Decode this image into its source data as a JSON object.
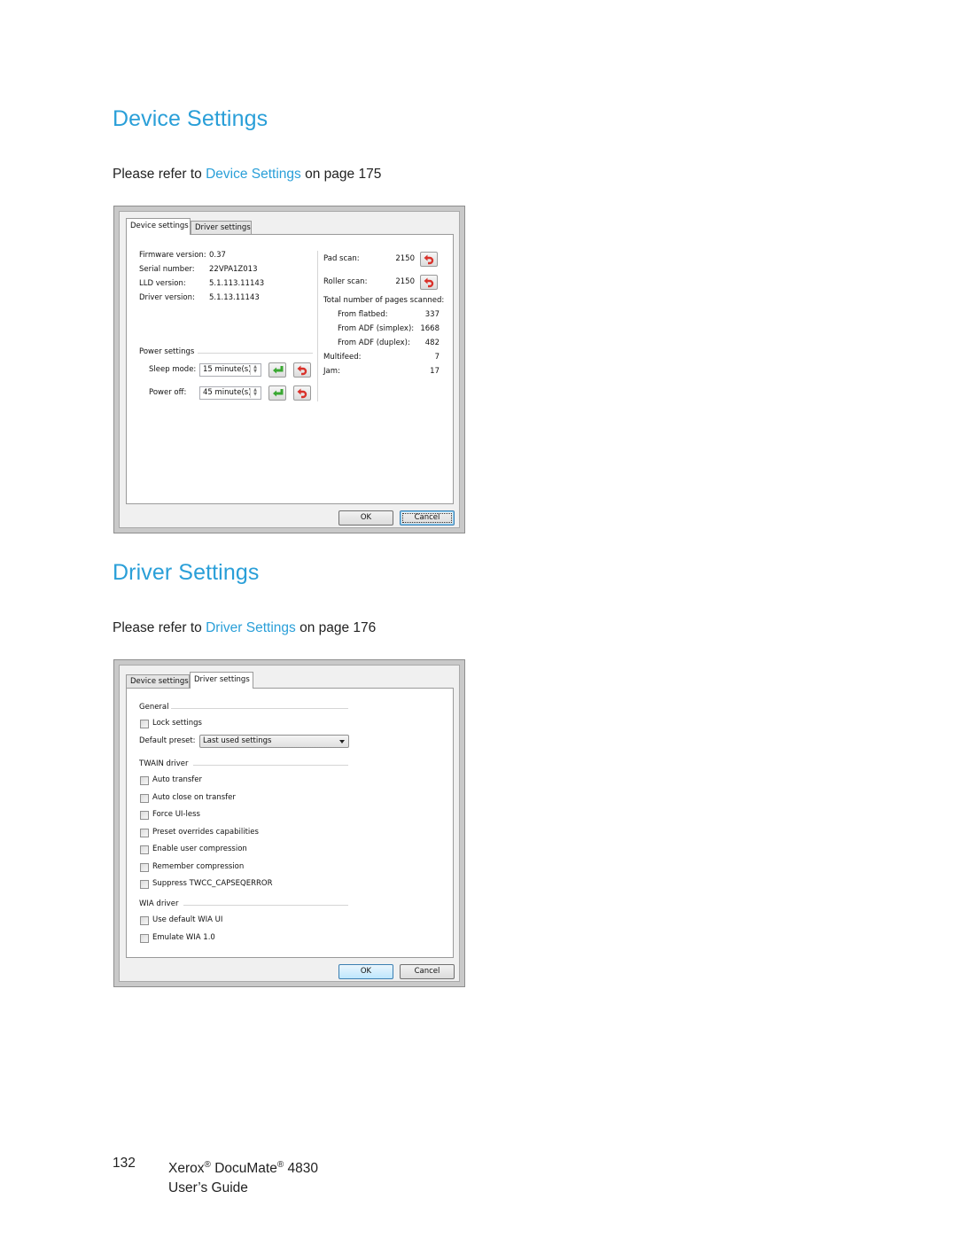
{
  "sections": [
    {
      "heading": "Device Settings",
      "refer_prefix": "Please refer to ",
      "refer_link": "Device Settings",
      "refer_suffix": " on page 175"
    },
    {
      "heading": "Driver Settings",
      "refer_prefix": "Please refer to ",
      "refer_link": "Driver Settings",
      "refer_suffix": " on page 176"
    }
  ],
  "colors": {
    "accent": "#2a9fd8",
    "reset_icon": "#d9322b",
    "apply_icon": "#3aa832"
  },
  "device_dialog": {
    "tabs": [
      "Device settings",
      "Driver settings"
    ],
    "active_tab": 0,
    "info": [
      {
        "label": "Firmware version:",
        "value": "0.37"
      },
      {
        "label": "Serial number:",
        "value": "22VPA1Z013"
      },
      {
        "label": "LLD version:",
        "value": "5.1.113.11143"
      },
      {
        "label": "Driver version:",
        "value": "5.1.13.11143"
      }
    ],
    "power_group": "Power settings",
    "sleep_label": "Sleep mode:",
    "sleep_value": "15 minute(s)",
    "poweroff_label": "Power off:",
    "poweroff_value": "45 minute(s)",
    "pad_scan_label": "Pad scan:",
    "pad_scan_value": "2150",
    "roller_scan_label": "Roller scan:",
    "roller_scan_value": "2150",
    "total_label": "Total number of pages scanned:",
    "counts": [
      {
        "label": "From flatbed:",
        "value": "337"
      },
      {
        "label": "From ADF (simplex):",
        "value": "1668"
      },
      {
        "label": "From ADF (duplex):",
        "value": "482"
      }
    ],
    "multifeed_label": "Multifeed:",
    "multifeed_value": "7",
    "jam_label": "Jam:",
    "jam_value": "17",
    "ok_label": "OK",
    "cancel_label": "Cancel",
    "icons": {
      "reset": "undo-arrow-icon",
      "apply": "enter-arrow-icon"
    }
  },
  "driver_dialog": {
    "tabs": [
      "Device settings",
      "Driver settings"
    ],
    "active_tab": 1,
    "general_group": "General",
    "lock_settings": "Lock settings",
    "default_preset_label": "Default preset:",
    "default_preset_value": "Last used settings",
    "twain_group": "TWAIN driver",
    "twain_options": [
      "Auto transfer",
      "Auto close on transfer",
      "Force UI-less",
      "Preset overrides capabilities",
      "Enable user compression",
      "Remember compression",
      "Suppress TWCC_CAPSEQERROR"
    ],
    "wia_group": "WIA driver",
    "wia_options": [
      "Use default WIA UI",
      "Emulate WIA 1.0"
    ],
    "ok_label": "OK",
    "cancel_label": "Cancel"
  },
  "footer": {
    "page_number": "132",
    "product_brand": "Xerox",
    "product_name": "DocuMate",
    "registered": "®",
    "model": "4830",
    "guide": "User’s Guide"
  }
}
